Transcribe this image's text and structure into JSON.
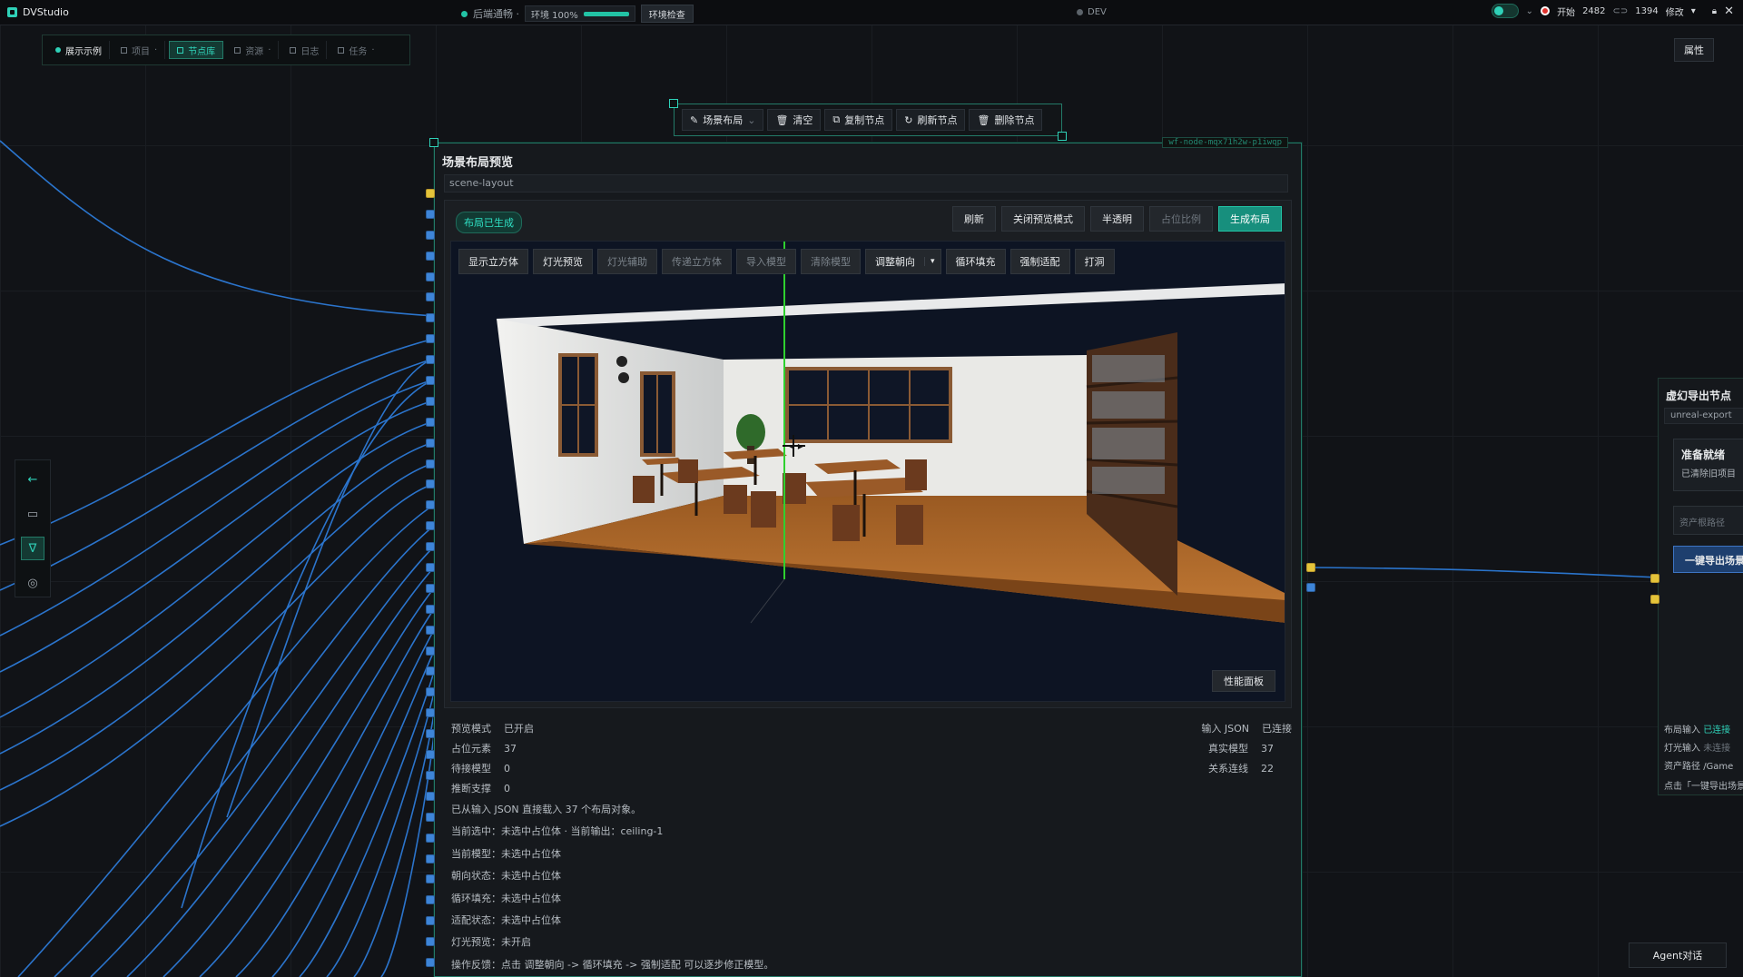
{
  "app": {
    "title": "DVStudio"
  },
  "status": {
    "backend_label": "后端通畅 ·",
    "env_label": "环境 100%",
    "env_progress": 1.0,
    "env_check_label": "环境检查",
    "dev_label": "DEV"
  },
  "topright": {
    "start_label": "开始",
    "coord_x": "2482",
    "coord_y": "1394",
    "modify_label": "修改"
  },
  "nav": {
    "items": [
      "展示示例",
      "项目",
      "节点库",
      "资源",
      "日志",
      "任务"
    ]
  },
  "attr_label": "属性",
  "node_toolbar": {
    "scene_label": "场景布局",
    "clear_label": "清空",
    "copy_label": "复制节点",
    "refresh_label": "刷新节点",
    "delete_label": "删除节点"
  },
  "panel": {
    "node_id": "wf-node-mqx71h2w-p1iwqp",
    "title": "场景布局预览",
    "subtitle": "scene-layout",
    "badge": "布局已生成",
    "actions": [
      "刷新",
      "关闭预览模式",
      "半透明",
      "占位比例",
      "生成布局"
    ],
    "vp_tools": [
      "显示立方体",
      "灯光预览",
      "灯光辅助",
      "传递立方体",
      "导入模型",
      "清除模型",
      "调整朝向",
      "循环填充",
      "强制适配",
      "打洞"
    ],
    "perf_label": "性能面板",
    "info_left": [
      {
        "k": "预览模式",
        "v": "已开启"
      },
      {
        "k": "占位元素",
        "v": "37"
      },
      {
        "k": "待接模型",
        "v": "0"
      },
      {
        "k": "推断支撑",
        "v": "0"
      }
    ],
    "info_right": [
      {
        "k": "输入 JSON",
        "v": "已连接"
      },
      {
        "k": "真实模型",
        "v": "37"
      },
      {
        "k": "关系连线",
        "v": "22"
      }
    ],
    "log": [
      "已从输入 JSON 直接载入 37 个布局对象。",
      "当前选中：未选中占位体 · 当前输出：ceiling-1",
      "当前模型：未选中占位体",
      "朝向状态：未选中占位体",
      "循环填充：未选中占位体",
      "适配状态：未选中占位体",
      "灯光预览：未开启",
      "操作反馈：点击 调整朝向 -> 循环填充 -> 强制适配 可以逐步修正模型。"
    ]
  },
  "export_node": {
    "title": "虚幻导出节点",
    "subtitle": "unreal-export",
    "ready_title": "准备就绪",
    "ready_sub": "已清除旧项目",
    "asset_placeholder": "资产根路径",
    "export_button": "一键导出场景",
    "stats": [
      {
        "k": "布局输入",
        "v": "已连接"
      },
      {
        "k": "灯光输入",
        "v": "未连接"
      },
      {
        "k": "资产路径",
        "v": "/Game"
      },
      {
        "k": "点击「一键导出场景」",
        "v": ""
      }
    ]
  },
  "agent_label": "Agent对话",
  "colors": {
    "accent": "#2fd1b8",
    "port_blue": "#3e85d8",
    "port_yellow": "#e4c43a",
    "wire": "#2e7fe0",
    "primary": "#178f7d"
  }
}
